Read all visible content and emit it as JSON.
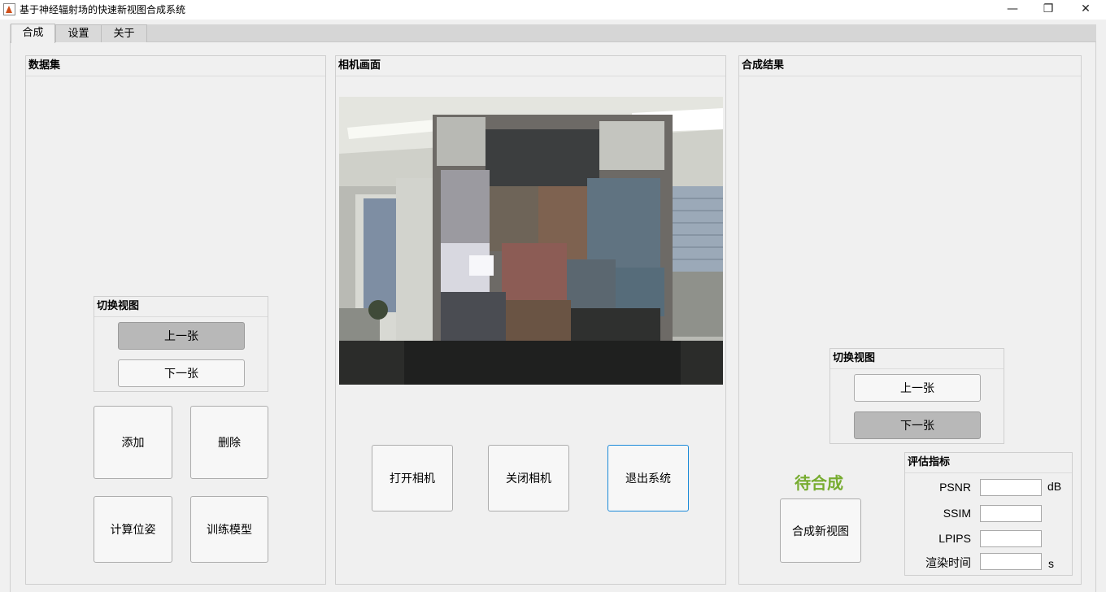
{
  "window": {
    "title": "基于神经辐射场的快速新视图合成系统",
    "minimize_glyph": "—",
    "maximize_glyph": "❐",
    "close_glyph": "✕"
  },
  "tabs": [
    "合成",
    "设置",
    "关于"
  ],
  "dataset": {
    "title": "数据集",
    "switch_view": {
      "title": "切换视图",
      "prev": "上一张",
      "next": "下一张"
    },
    "add": "添加",
    "delete": "删除",
    "compute_pose": "计算位姿",
    "train_model": "训练模型"
  },
  "camera": {
    "title": "相机画面",
    "open": "打开相机",
    "close": "关闭相机",
    "exit": "退出系统"
  },
  "result": {
    "title": "合成结果",
    "switch_view": {
      "title": "切换视图",
      "prev": "上一张",
      "next": "下一张"
    },
    "status": "待合成",
    "status_color": "#77ac30",
    "synthesize": "合成新视图",
    "metrics": {
      "title": "评估指标",
      "psnr_label": "PSNR",
      "psnr_unit": "dB",
      "psnr_value": "",
      "ssim_label": "SSIM",
      "ssim_value": "",
      "lpips_label": "LPIPS",
      "lpips_value": "",
      "render_label": "渲染时间",
      "render_unit": "s",
      "render_value": ""
    }
  },
  "icons": [
    "matlab-app-icon",
    "minimize-icon",
    "maximize-icon",
    "close-icon"
  ]
}
